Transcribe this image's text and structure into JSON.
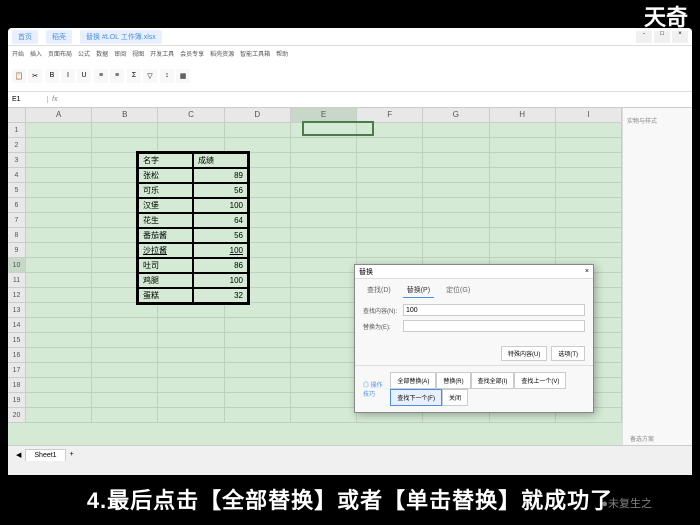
{
  "overlay_text": "天奇",
  "caption": "4.最后点击【全部替换】或者【单击替换】就成功了",
  "watermark": "●未复生之",
  "titlebar": {
    "tab1": "首页",
    "tab2": "稻壳",
    "tab3": "替换 #LOL 工作簿.xlsx"
  },
  "menu": [
    "开始",
    "插入",
    "页面布局",
    "公式",
    "数据",
    "审阅",
    "视图",
    "开发工具",
    "会员专享",
    "稻壳资源",
    "智能工具箱",
    "帮助"
  ],
  "formula": {
    "ref": "E1",
    "fx": "fx"
  },
  "columns": [
    "A",
    "B",
    "C",
    "D",
    "E",
    "F",
    "G",
    "H",
    "I"
  ],
  "active_col_idx": 4,
  "active_row": 10,
  "chart_data": {
    "type": "table",
    "headers": [
      "名字",
      "成绩"
    ],
    "rows": [
      [
        "张松",
        89
      ],
      [
        "可乐",
        56
      ],
      [
        "汉堡",
        100
      ],
      [
        "花生",
        64
      ],
      [
        "番茄酱",
        56
      ],
      [
        "沙拉酱",
        100
      ],
      [
        "吐司",
        86
      ],
      [
        "鸡腿",
        100
      ],
      [
        "蛋糕",
        32
      ]
    ],
    "highlight_rows": [
      5
    ]
  },
  "dialog": {
    "title": "替换",
    "tabs": [
      "查找(D)",
      "替换(P)",
      "定位(G)"
    ],
    "active_tab": 1,
    "find_label": "查找内容(N):",
    "find_value": "100",
    "replace_label": "替换为(E):",
    "replace_value": "",
    "options_btn": "特殊内容(U)",
    "options_btn2": "选项(T)",
    "help": "◎ 操作技巧",
    "buttons": [
      "全部替换(A)",
      "替换(R)",
      "查找全部(I)",
      "查找上一个(V)",
      "查找下一个(F)",
      "关闭"
    ]
  },
  "right_panel": {
    "title": "实物与样式"
  },
  "sheet_tab": "Sheet1",
  "sidebar_bottom": "备选方案"
}
